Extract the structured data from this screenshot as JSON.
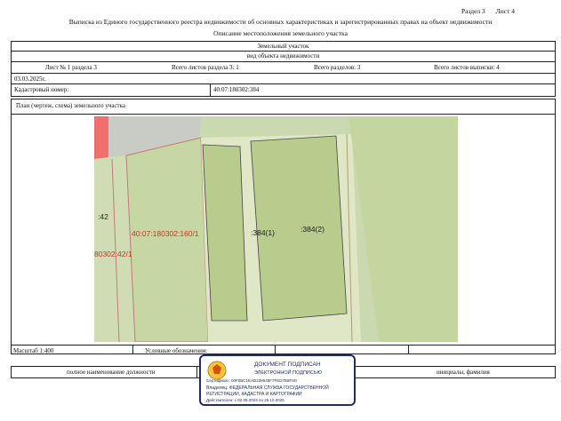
{
  "page_header": {
    "section": "Раздел 3",
    "sheet": "Лист 4"
  },
  "title": "Выписка из Единого государственного реестра недвижимости об основных характеристиках и зарегистрированных правах на объект недвижимости",
  "subtitle": "Описание местоположения земельного участка",
  "object_type": "Земельный участок",
  "object_type_caption": "вид объекта недвижимости",
  "sheet_info": {
    "sheet_no": "Лист № 1 раздела 3",
    "total_sheets_section": "Всего листов раздела 3: 1",
    "total_sections": "Всего разделов: 3",
    "total_sheets_extract": "Всего листов выписки: 4"
  },
  "date": "03.03.2025г.",
  "cadastral_label": "Кадастровый номер:",
  "cadastral_number": "40:07:180302:384",
  "plan_title": "План (чертеж, схема) земельного участка",
  "map_labels": {
    "l1": ":384(1)",
    "l2": ":384(2)",
    "l3": "40:07:180302:160/1",
    "l4": "80302:42/1",
    "l5": ":42"
  },
  "scale": "Масштаб 1:400",
  "legend": "Условные обозначения:",
  "position_caption": "полное наименование должности",
  "initials_caption": "инициалы, фамилия",
  "stamp": {
    "title": "ДОКУМЕНТ ПОДПИСАН",
    "subtitle": "ЭЛЕКТРОННОЙ ПОДПИСЬЮ",
    "certificate": "Сертификат: 00F0BC1EAD238645F7FED7B8F8G",
    "owner": "Владелец: ФЕДЕРАЛЬНАЯ СЛУЖБА ГОСУДАРСТВЕННОЙ",
    "owner2": "РЕГИСТРАЦИИ, КАДАСТРА И КАРТОГРАФИИ",
    "valid": "Действителен: с 02.08.2024 по 26.10.2025"
  }
}
